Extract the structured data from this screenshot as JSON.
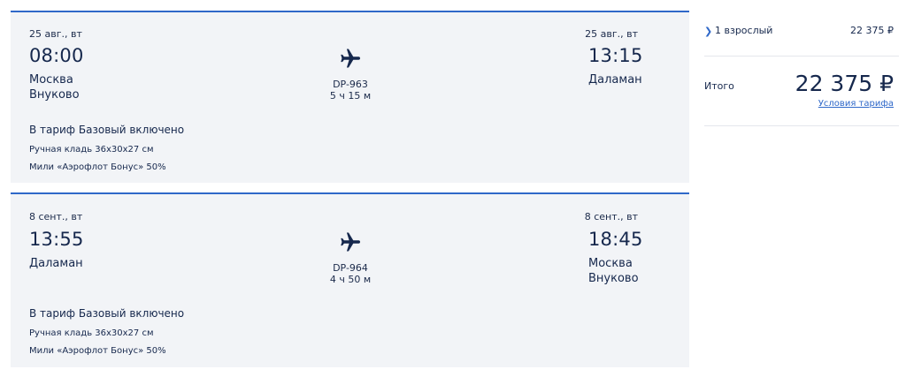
{
  "segments": [
    {
      "departure": {
        "date": "25 авг., вт",
        "time": "08:00",
        "city": "Москва",
        "airport": "Внуково"
      },
      "flight": {
        "number": "DP-963",
        "duration": "5 ч 15 м",
        "icon": "airplane-icon"
      },
      "arrival": {
        "date": "25 авг., вт",
        "time": "13:15",
        "city": "Даламан",
        "airport": ""
      },
      "tariff": {
        "title": "В тариф Базовый включено",
        "features": [
          "Ручная кладь 36x30x27 см",
          "Мили «Аэрофлот Бонус» 50%"
        ]
      }
    },
    {
      "departure": {
        "date": "8 сент., вт",
        "time": "13:55",
        "city": "Даламан",
        "airport": ""
      },
      "flight": {
        "number": "DP-964",
        "duration": "4 ч 50 м",
        "icon": "airplane-icon"
      },
      "arrival": {
        "date": "8 сент., вт",
        "time": "18:45",
        "city": "Москва",
        "airport": "Внуково"
      },
      "tariff": {
        "title": "В тариф Базовый включено",
        "features": [
          "Ручная кладь 36x30x27 см",
          "Мили «Аэрофлот Бонус» 50%"
        ]
      }
    }
  ],
  "summary": {
    "passengers_label": "1 взрослый",
    "passengers_price": "22 375 ₽",
    "total_label": "Итого",
    "total_price": "22 375 ₽",
    "terms_link": "Условия тарифа"
  },
  "colors": {
    "accent": "#2f68c9",
    "card_bg": "#f2f4f7",
    "text": "#16284d"
  }
}
